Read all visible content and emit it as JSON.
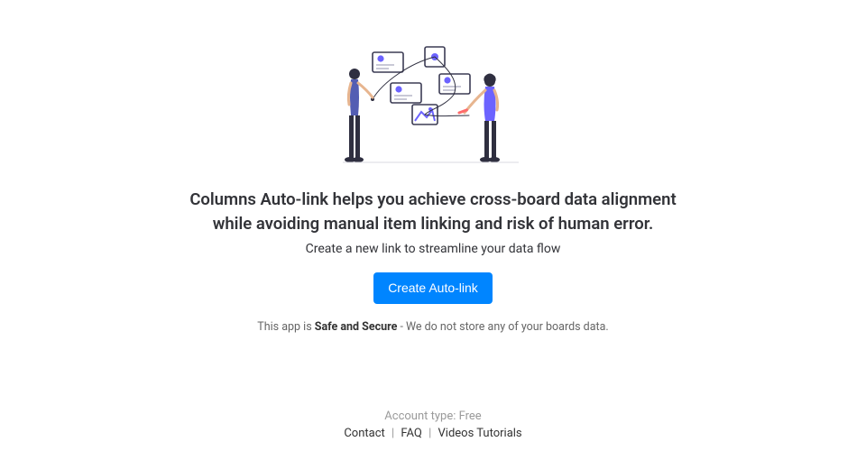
{
  "hero": {
    "headline": "Columns Auto-link helps you achieve cross-board data alignment\nwhile avoiding manual item linking and risk of human error.",
    "subheadline": "Create a new link to streamline your data flow",
    "cta_label": "Create Auto-link",
    "safe_prefix": "This app is ",
    "safe_bold": "Safe and Secure",
    "safe_suffix": " - We do not store any of your boards data."
  },
  "footer": {
    "account_line": "Account type: Free",
    "links": {
      "contact": "Contact",
      "faq": "FAQ",
      "videos": "Videos Tutorials"
    }
  }
}
